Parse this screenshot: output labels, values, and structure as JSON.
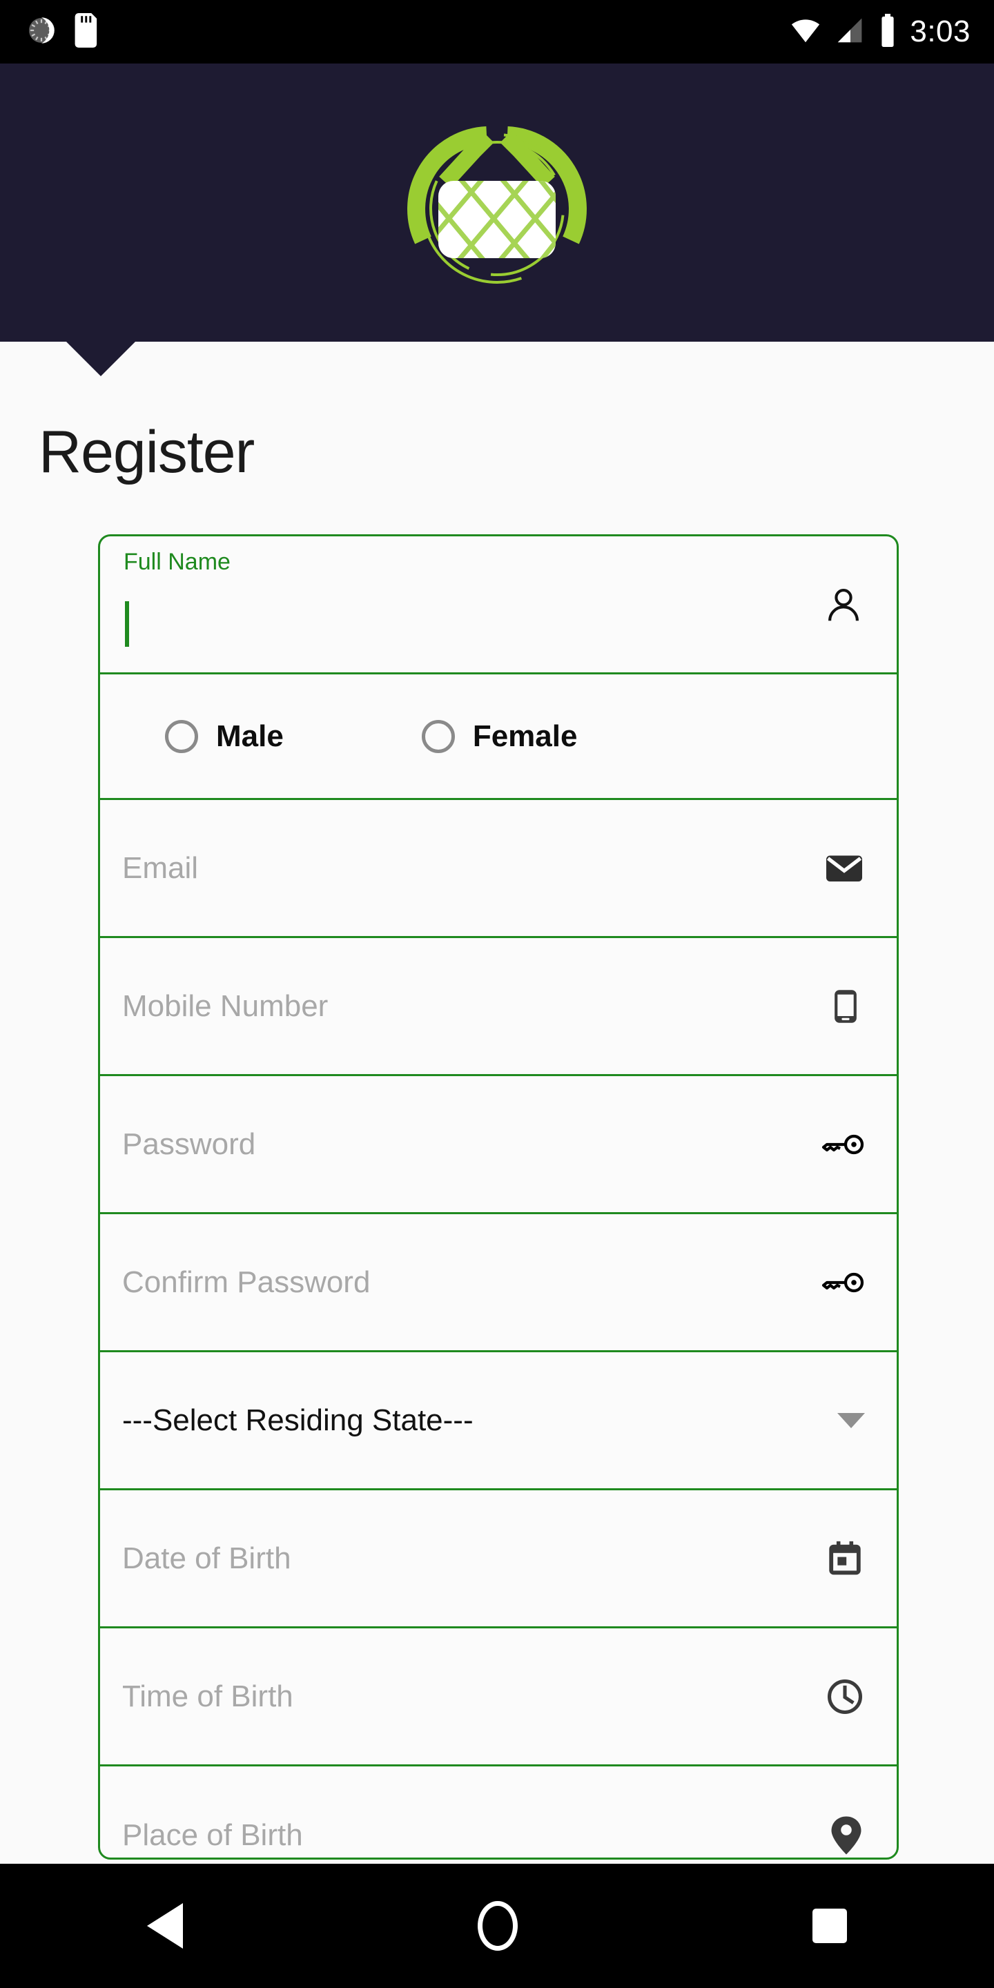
{
  "statusbar": {
    "time": "3:03",
    "left_icons": [
      "sync-spinner-icon",
      "sd-card-icon"
    ],
    "right_icons": [
      "wifi-icon",
      "cellular-signal-icon",
      "battery-icon"
    ]
  },
  "header": {
    "logo": "app-logo-lattice-in-circle",
    "background_color": "#1e1b32",
    "accent_color": "#9acd32"
  },
  "page": {
    "title": "Register",
    "accent_color": "#1f8a1f"
  },
  "form": {
    "full_name": {
      "label": "Full Name",
      "value": "",
      "placeholder": "",
      "icon": "person-icon"
    },
    "gender": {
      "options": [
        {
          "label": "Male",
          "selected": false
        },
        {
          "label": "Female",
          "selected": false
        }
      ]
    },
    "email": {
      "placeholder": "Email",
      "value": "",
      "icon": "envelope-icon"
    },
    "mobile": {
      "placeholder": "Mobile Number",
      "value": "",
      "icon": "mobile-phone-icon"
    },
    "password": {
      "placeholder": "Password",
      "value": "",
      "icon": "key-icon"
    },
    "confirm_password": {
      "placeholder": "Confirm Password",
      "value": "",
      "icon": "key-icon"
    },
    "residing_state": {
      "selected": "---Select Residing State---",
      "icon": "chevron-down-icon"
    },
    "date_of_birth": {
      "placeholder": "Date of Birth",
      "value": "",
      "icon": "calendar-icon"
    },
    "time_of_birth": {
      "placeholder": "Time of Birth",
      "value": "",
      "icon": "clock-icon"
    },
    "place_of_birth": {
      "placeholder": "Place of Birth",
      "value": "",
      "icon": "location-pin-icon"
    }
  },
  "navbar": {
    "back": "back-triangle-icon",
    "home": "home-circle-icon",
    "recents": "recents-square-icon"
  }
}
